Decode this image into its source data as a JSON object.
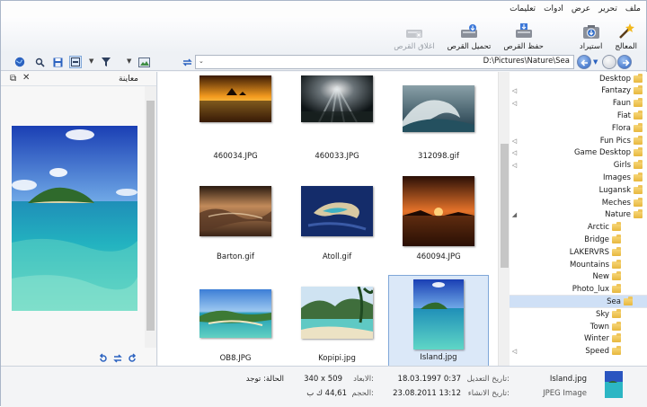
{
  "menu": [
    "ملف",
    "تحرير",
    "عرض",
    "ادوات",
    "تعليمات"
  ],
  "toolbar": {
    "wizard": "المعالج",
    "import": "استيراد",
    "save_disk": "حفظ القرص",
    "load_disk": "تحميل القرص",
    "close_disk": "اغلاق القرص"
  },
  "address": "D:\\Pictures\\Nature\\Sea",
  "preview": {
    "title": "معاينة"
  },
  "thumbnails": [
    {
      "name": "460034.JPG"
    },
    {
      "name": "460033.JPG"
    },
    {
      "name": "312098.gif"
    },
    {
      "name": "Barton.gif"
    },
    {
      "name": "Atoll.gif"
    },
    {
      "name": "460094.JPG"
    },
    {
      "name": "OB8.JPG"
    },
    {
      "name": "Kopipi.jpg"
    },
    {
      "name": "Island.jpg",
      "selected": true
    }
  ],
  "tree": {
    "top": [
      "Desktop",
      "Fantazy",
      "Faun",
      "Fiat",
      "Flora",
      "Fun Pics",
      "Game Desktop",
      "Girls",
      "Images",
      "Lugansk",
      "Meches",
      "Nature"
    ],
    "nature_children": [
      "Arctic",
      "Bridge",
      "LAKERVRS",
      "Mountains",
      "New",
      "Photo_lux",
      "Sea",
      "Sky",
      "Town",
      "Winter"
    ],
    "after": [
      "Speed"
    ],
    "expandable": [
      "Fantazy",
      "Faun",
      "Fun Pics",
      "Game Desktop",
      "Girls"
    ],
    "selected": "Sea"
  },
  "status": {
    "filename": "Island.jpg",
    "filetype": "JPEG Image",
    "modified_label": "تاريخ التعديل:",
    "modified_value": "18.03.1997 0:37",
    "created_label": "تاريخ الانشاء:",
    "created_value": "23.08.2011 13:12",
    "dims_label": "الابعاد:",
    "dims_value": "340 x 509",
    "size_label": "الحجم:",
    "size_value": "44,61 ك ب",
    "state": "الحالة: توجد"
  },
  "colors": {
    "accent": "#2b62c0",
    "selection": "#cfe0f6"
  }
}
